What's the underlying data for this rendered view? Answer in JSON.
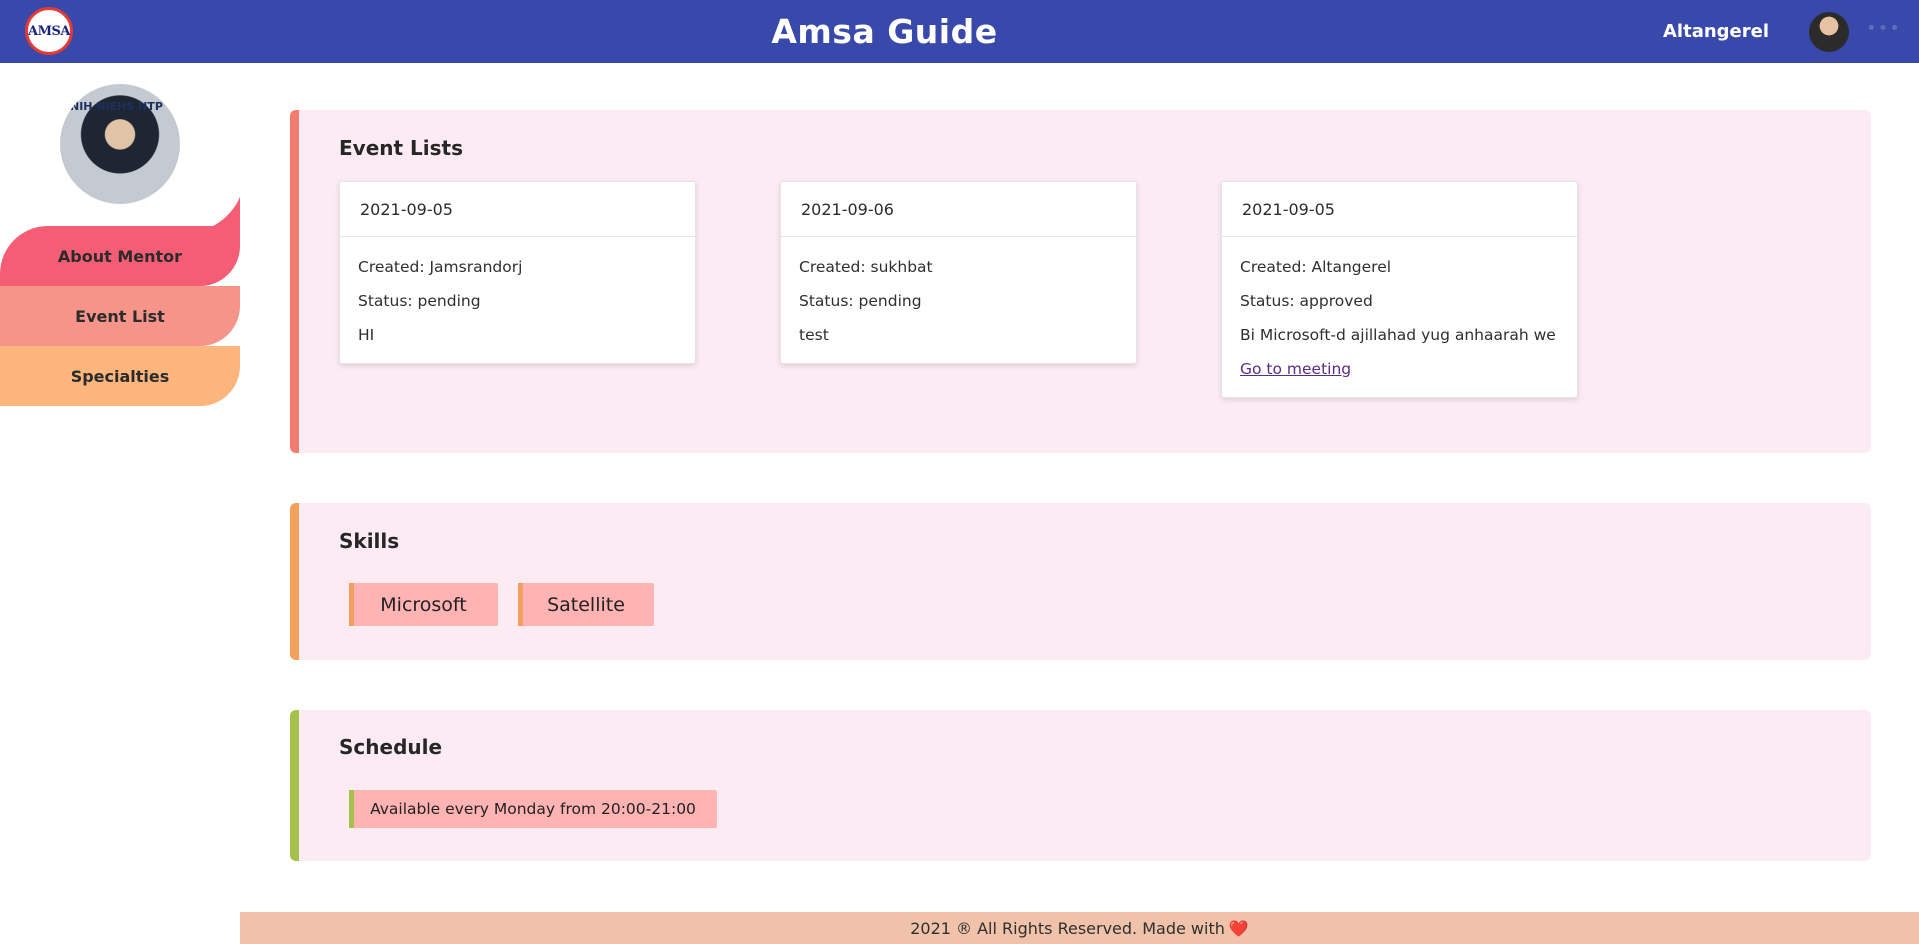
{
  "header": {
    "logo_text": "AMSA",
    "title": "Amsa Guide",
    "user_name": "Altangerel",
    "more_icon": "ellipsis-icon"
  },
  "sidebar": {
    "photo_caption": "NIH NIEHS NTP",
    "items": [
      {
        "label": "About Mentor",
        "color": "#f45d73"
      },
      {
        "label": "Event List",
        "color": "#f6948a"
      },
      {
        "label": "Specialties",
        "color": "#fbb57d"
      }
    ]
  },
  "events": {
    "title": "Event Lists",
    "accent": "#f47c6e",
    "cards": [
      {
        "date": "2021-09-05",
        "created": "Created: Jamsrandorj",
        "status": "Status: pending",
        "message": "HI"
      },
      {
        "date": "2021-09-06",
        "created": "Created: sukhbat",
        "status": "Status: pending",
        "message": "test"
      },
      {
        "date": "2021-09-05",
        "created": "Created: Altangerel",
        "status": "Status: approved",
        "message": "Bi Microsoft-d ajillahad yug anhaarah we",
        "link": "Go to meeting"
      }
    ]
  },
  "skills": {
    "title": "Skills",
    "accent": "#f5a15e",
    "items": [
      "Microsoft",
      "Satellite"
    ]
  },
  "schedule": {
    "title": "Schedule",
    "accent": "#a5c14a",
    "items": [
      "Available every Monday from 20:00-21:00"
    ]
  },
  "footer": {
    "text": "2021 ® All Rights Reserved. Made with",
    "heart": "❤️"
  }
}
